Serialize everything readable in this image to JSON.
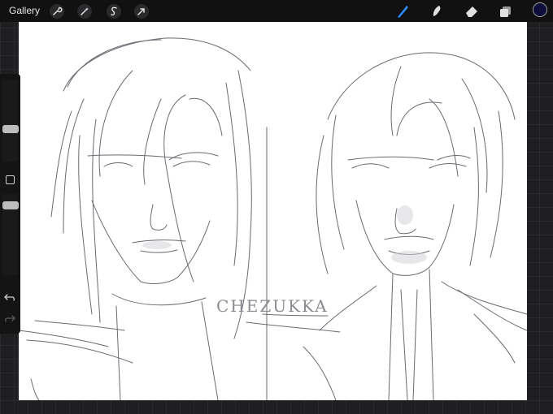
{
  "toolbar": {
    "gallery_label": "Gallery",
    "left_tools": [
      {
        "name": "actions",
        "icon": "wrench-icon"
      },
      {
        "name": "adjustments",
        "icon": "magic-wand-icon"
      },
      {
        "name": "selection",
        "icon": "selection-s-icon"
      },
      {
        "name": "transform",
        "icon": "arrow-cursor-icon"
      }
    ],
    "right_tools": [
      {
        "name": "brush",
        "icon": "brush-icon",
        "active": true
      },
      {
        "name": "smudge",
        "icon": "smudge-icon"
      },
      {
        "name": "eraser",
        "icon": "eraser-icon"
      },
      {
        "name": "layers",
        "icon": "layers-icon"
      }
    ],
    "current_color": "#0e0e3a",
    "active_tool_color": "#2f8cff"
  },
  "canvas": {
    "watermark": "CHEZUKKA",
    "stroke_color": "#6a6a72"
  },
  "sidebar": {
    "brush_size_level": 0.5,
    "opacity_level": 0.3,
    "icons": [
      "modify-square-icon",
      "undo-icon",
      "redo-icon"
    ]
  }
}
